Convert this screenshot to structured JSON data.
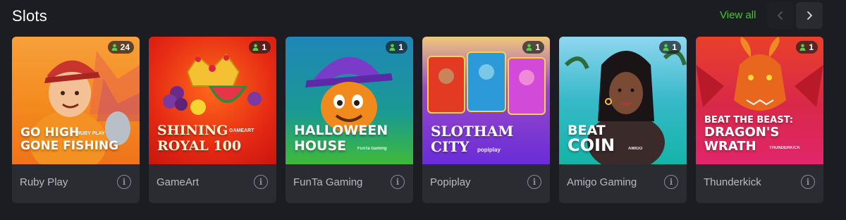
{
  "section": {
    "title": "Slots",
    "view_all": "View all"
  },
  "colors": {
    "background": "#1c1d22",
    "card": "#2b2c32",
    "accent": "#45c52e",
    "provider_text": "#b9bac0"
  },
  "cards": [
    {
      "title_line1": "GO HIGH",
      "title_line2": "GONE FISHING",
      "studio": "RUBY PLAY",
      "players": "24",
      "provider": "Ruby Play",
      "icon": "user-icon"
    },
    {
      "title_line1": "SHINING",
      "title_line2": "ROYAL 100",
      "studio": "GAMEART",
      "players": "1",
      "provider": "GameArt",
      "icon": "user-icon"
    },
    {
      "title_line1": "HALLOWEEN",
      "title_line2": "HOUSE",
      "studio": "FunTa Gaming",
      "players": "1",
      "provider": "FunTa Gaming",
      "icon": "user-icon"
    },
    {
      "title_line1": "SLOTHAM",
      "title_line2": "CITY",
      "studio": "popiplay",
      "players": "1",
      "provider": "Popiplay",
      "icon": "user-icon"
    },
    {
      "title_line1": "BEAT",
      "title_line2": "COIN",
      "studio": "AMIGO",
      "players": "1",
      "provider": "Amigo Gaming",
      "icon": "user-icon"
    },
    {
      "title_line1": "BEAT THE BEAST:",
      "title_line2": "DRAGON'S",
      "title_line3": "WRATH",
      "studio": "THUNDERKICK",
      "players": "1",
      "provider": "Thunderkick",
      "icon": "user-icon"
    }
  ]
}
